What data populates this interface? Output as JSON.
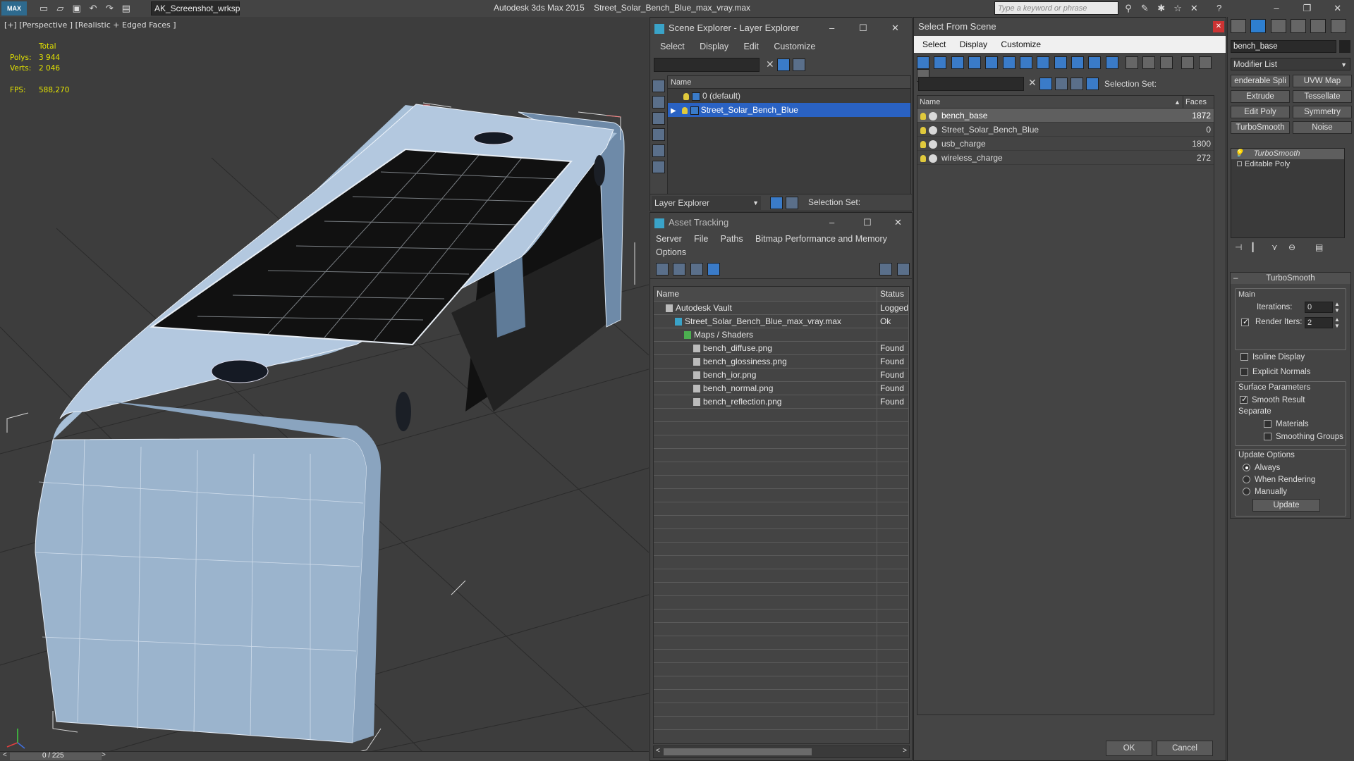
{
  "titlebar": {
    "workspace": "AK_Screenshot_wrksp",
    "app": "Autodesk 3ds Max  2015",
    "file": "Street_Solar_Bench_Blue_max_vray.max",
    "search_placeholder": "Type a keyword or phrase"
  },
  "viewport": {
    "label": "[+] [Perspective ] [Realistic + Edged Faces ]",
    "stats": {
      "total_label": "Total",
      "polys_label": "Polys:",
      "polys": "3 944",
      "verts_label": "Verts:",
      "verts": "2 046",
      "fps_label": "FPS:",
      "fps": "588,270"
    }
  },
  "statusbar": {
    "frame": "0 / 225"
  },
  "scene_explorer": {
    "title": "Scene Explorer - Layer Explorer",
    "menu": [
      "Select",
      "Display",
      "Edit",
      "Customize"
    ],
    "col_name": "Name",
    "layers": [
      {
        "name": "0 (default)",
        "selected": false
      },
      {
        "name": "Street_Solar_Bench_Blue",
        "selected": true
      }
    ],
    "footer_dropdown": "Layer Explorer",
    "selection_set_label": "Selection Set:"
  },
  "asset_tracking": {
    "title": "Asset Tracking",
    "menu": [
      "Server",
      "File",
      "Paths",
      "Bitmap Performance and Memory"
    ],
    "menu2": "Options",
    "col_name": "Name",
    "col_status": "Status",
    "rows": [
      {
        "name": "Autodesk Vault",
        "status": "Logged",
        "indent": 1
      },
      {
        "name": "Street_Solar_Bench_Blue_max_vray.max",
        "status": "Ok",
        "indent": 2
      },
      {
        "name": "Maps / Shaders",
        "status": "",
        "indent": 3
      },
      {
        "name": "bench_diffuse.png",
        "status": "Found",
        "indent": 4
      },
      {
        "name": "bench_glossiness.png",
        "status": "Found",
        "indent": 4
      },
      {
        "name": "bench_ior.png",
        "status": "Found",
        "indent": 4
      },
      {
        "name": "bench_normal.png",
        "status": "Found",
        "indent": 4
      },
      {
        "name": "bench_reflection.png",
        "status": "Found",
        "indent": 4
      }
    ]
  },
  "select_from_scene": {
    "title": "Select From Scene",
    "menu": [
      "Select",
      "Display",
      "Customize"
    ],
    "selection_set_label": "Selection Set:",
    "col_name": "Name",
    "col_faces": "Faces",
    "objects": [
      {
        "name": "bench_base",
        "faces": "1872",
        "selected": true
      },
      {
        "name": "Street_Solar_Bench_Blue",
        "faces": "0",
        "selected": false
      },
      {
        "name": "usb_charge",
        "faces": "1800",
        "selected": false
      },
      {
        "name": "wireless_charge",
        "faces": "272",
        "selected": false
      }
    ],
    "ok": "OK",
    "cancel": "Cancel"
  },
  "modify_panel": {
    "object_name": "bench_base",
    "modifier_list": "Modifier List",
    "buttons": [
      "enderable Spli",
      "UVW Map",
      "Extrude",
      "Tessellate",
      "Edit Poly",
      "Symmetry",
      "TurboSmooth",
      "Noise"
    ],
    "stack": [
      "TurboSmooth",
      "Editable Poly"
    ],
    "rollout_title": "TurboSmooth",
    "main_label": "Main",
    "iterations_label": "Iterations:",
    "iterations": "0",
    "render_iters_label": "Render Iters:",
    "render_iters": "2",
    "isoline": "Isoline Display",
    "explicit_normals": "Explicit Normals",
    "surface_params": "Surface Parameters",
    "smooth_result": "Smooth Result",
    "separate": "Separate",
    "materials": "Materials",
    "smoothing_groups": "Smoothing Groups",
    "update_options": "Update Options",
    "always": "Always",
    "when_rendering": "When Rendering",
    "manually": "Manually",
    "update": "Update"
  }
}
